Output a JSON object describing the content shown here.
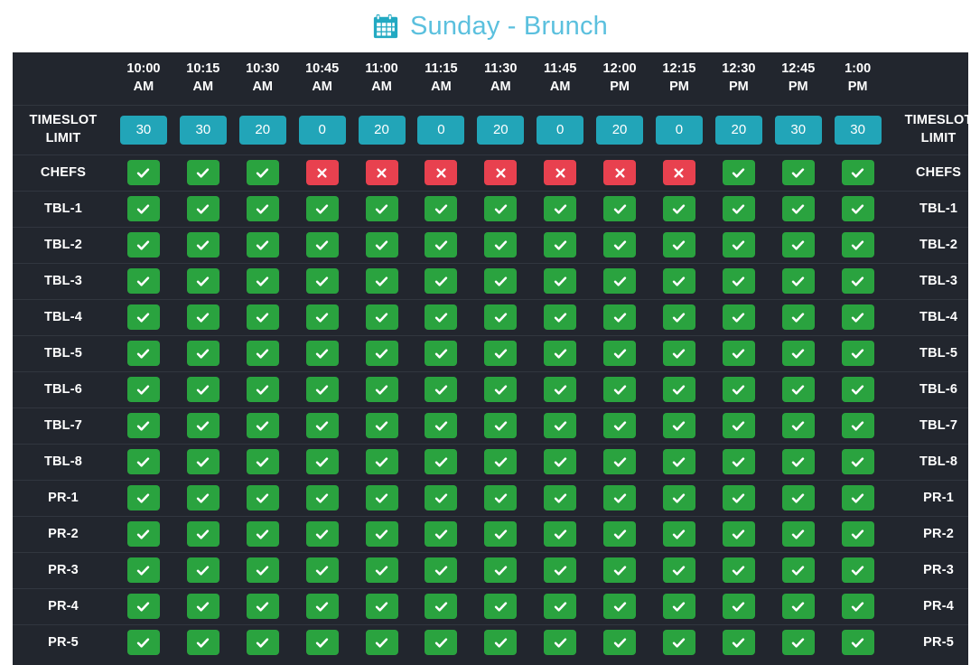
{
  "header": {
    "icon": "calendar-icon",
    "title": "Sunday - Brunch",
    "title_color": "#5bc0de"
  },
  "colors": {
    "background": "#22262e",
    "row_divider": "#31363f",
    "teal_pill": "#22a5b8",
    "available_green": "#2aa33f",
    "unavailable_red": "#e8414f",
    "text": "#ffffff"
  },
  "table": {
    "side_label_line1": "TIMESLOT",
    "side_label_line2": "LIMIT",
    "timeslots": [
      {
        "time": "10:00",
        "meridiem": "AM"
      },
      {
        "time": "10:15",
        "meridiem": "AM"
      },
      {
        "time": "10:30",
        "meridiem": "AM"
      },
      {
        "time": "10:45",
        "meridiem": "AM"
      },
      {
        "time": "11:00",
        "meridiem": "AM"
      },
      {
        "time": "11:15",
        "meridiem": "AM"
      },
      {
        "time": "11:30",
        "meridiem": "AM"
      },
      {
        "time": "11:45",
        "meridiem": "AM"
      },
      {
        "time": "12:00",
        "meridiem": "PM"
      },
      {
        "time": "12:15",
        "meridiem": "PM"
      },
      {
        "time": "12:30",
        "meridiem": "PM"
      },
      {
        "time": "12:45",
        "meridiem": "PM"
      },
      {
        "time": "1:00",
        "meridiem": "PM"
      }
    ],
    "timeslot_limits": [
      30,
      30,
      20,
      0,
      20,
      0,
      20,
      0,
      20,
      0,
      20,
      30,
      30
    ],
    "rows": [
      {
        "label": "CHEFS",
        "cells": [
          "ok",
          "ok",
          "ok",
          "no",
          "no",
          "no",
          "no",
          "no",
          "no",
          "no",
          "ok",
          "ok",
          "ok"
        ]
      },
      {
        "label": "TBL-1",
        "cells": [
          "ok",
          "ok",
          "ok",
          "ok",
          "ok",
          "ok",
          "ok",
          "ok",
          "ok",
          "ok",
          "ok",
          "ok",
          "ok"
        ]
      },
      {
        "label": "TBL-2",
        "cells": [
          "ok",
          "ok",
          "ok",
          "ok",
          "ok",
          "ok",
          "ok",
          "ok",
          "ok",
          "ok",
          "ok",
          "ok",
          "ok"
        ]
      },
      {
        "label": "TBL-3",
        "cells": [
          "ok",
          "ok",
          "ok",
          "ok",
          "ok",
          "ok",
          "ok",
          "ok",
          "ok",
          "ok",
          "ok",
          "ok",
          "ok"
        ]
      },
      {
        "label": "TBL-4",
        "cells": [
          "ok",
          "ok",
          "ok",
          "ok",
          "ok",
          "ok",
          "ok",
          "ok",
          "ok",
          "ok",
          "ok",
          "ok",
          "ok"
        ]
      },
      {
        "label": "TBL-5",
        "cells": [
          "ok",
          "ok",
          "ok",
          "ok",
          "ok",
          "ok",
          "ok",
          "ok",
          "ok",
          "ok",
          "ok",
          "ok",
          "ok"
        ]
      },
      {
        "label": "TBL-6",
        "cells": [
          "ok",
          "ok",
          "ok",
          "ok",
          "ok",
          "ok",
          "ok",
          "ok",
          "ok",
          "ok",
          "ok",
          "ok",
          "ok"
        ]
      },
      {
        "label": "TBL-7",
        "cells": [
          "ok",
          "ok",
          "ok",
          "ok",
          "ok",
          "ok",
          "ok",
          "ok",
          "ok",
          "ok",
          "ok",
          "ok",
          "ok"
        ]
      },
      {
        "label": "TBL-8",
        "cells": [
          "ok",
          "ok",
          "ok",
          "ok",
          "ok",
          "ok",
          "ok",
          "ok",
          "ok",
          "ok",
          "ok",
          "ok",
          "ok"
        ]
      },
      {
        "label": "PR-1",
        "cells": [
          "ok",
          "ok",
          "ok",
          "ok",
          "ok",
          "ok",
          "ok",
          "ok",
          "ok",
          "ok",
          "ok",
          "ok",
          "ok"
        ]
      },
      {
        "label": "PR-2",
        "cells": [
          "ok",
          "ok",
          "ok",
          "ok",
          "ok",
          "ok",
          "ok",
          "ok",
          "ok",
          "ok",
          "ok",
          "ok",
          "ok"
        ]
      },
      {
        "label": "PR-3",
        "cells": [
          "ok",
          "ok",
          "ok",
          "ok",
          "ok",
          "ok",
          "ok",
          "ok",
          "ok",
          "ok",
          "ok",
          "ok",
          "ok"
        ]
      },
      {
        "label": "PR-4",
        "cells": [
          "ok",
          "ok",
          "ok",
          "ok",
          "ok",
          "ok",
          "ok",
          "ok",
          "ok",
          "ok",
          "ok",
          "ok",
          "ok"
        ]
      },
      {
        "label": "PR-5",
        "cells": [
          "ok",
          "ok",
          "ok",
          "ok",
          "ok",
          "ok",
          "ok",
          "ok",
          "ok",
          "ok",
          "ok",
          "ok",
          "ok"
        ]
      }
    ]
  }
}
